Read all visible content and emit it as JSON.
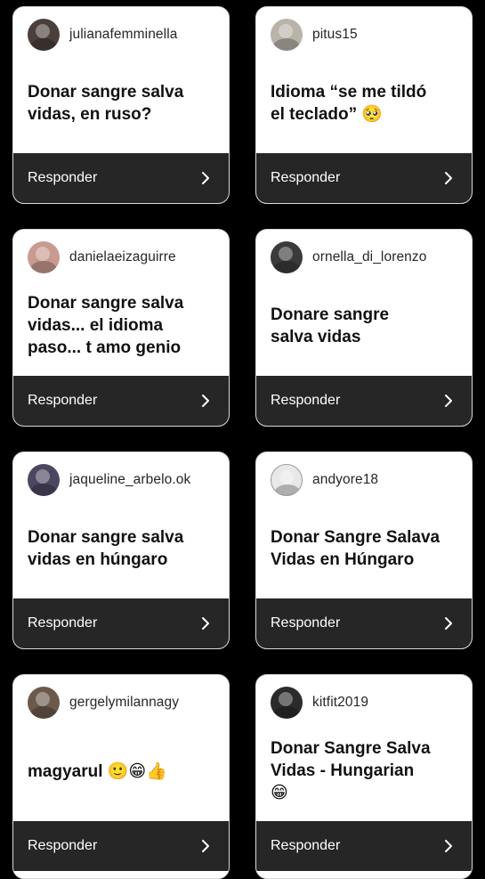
{
  "reply_label": "Responder",
  "chevron_icon": "chevron-right-icon",
  "cards": [
    {
      "username": "julianafemminella",
      "message_lines": [
        "Donar sangre salva",
        "vidas, en ruso?"
      ]
    },
    {
      "username": "pitus15",
      "message_lines": [
        "Idioma “se me tildó",
        "el teclado” 🥺"
      ]
    },
    {
      "username": "danielaeizaguirre",
      "message_lines": [
        "Donar sangre salva",
        "vidas... el idioma",
        "paso... t amo genio"
      ]
    },
    {
      "username": "ornella_di_lorenzo",
      "message_lines": [
        "Donare sangre",
        "salva vidas"
      ]
    },
    {
      "username": "jaqueline_arbelo.ok",
      "message_lines": [
        "Donar sangre salva",
        "vidas en húngaro"
      ]
    },
    {
      "username": "andyore18",
      "message_lines": [
        "Donar Sangre Salava",
        "Vidas en Húngaro"
      ]
    },
    {
      "username": "gergelymilannagy",
      "message_lines": [
        "magyarul 🙂😁👍"
      ]
    },
    {
      "username": "kitfit2019",
      "message_lines": [
        "Donar Sangre Salva",
        "Vidas - Hungarian",
        "😁"
      ]
    }
  ]
}
